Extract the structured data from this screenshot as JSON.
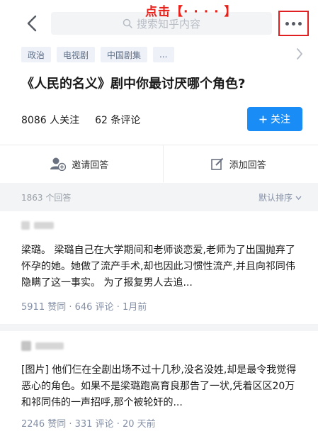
{
  "header": {
    "search_placeholder": "搜索知乎内容",
    "annotation": "点击【· · · · 】"
  },
  "topics": [
    "政治",
    "电视剧",
    "中国剧集",
    "..."
  ],
  "question": {
    "title": "《人民的名义》剧中你最讨厌哪个角色?",
    "followers": "8086 人关注",
    "comments": "62 条评论",
    "follow_label": "关注"
  },
  "actions": {
    "invite": "邀请回答",
    "add": "添加回答"
  },
  "answers_header": {
    "count": "1863 个回答",
    "sort": "默认排序"
  },
  "answers": [
    {
      "text": "梁璐。 梁璐自己在大学期间和老师谈恋爱,老师为了出国抛弃了怀孕的她。她做了流产手术,却也因此习惯性流产,并且向祁同伟隐瞒了这一事实。 为了报复男人去追...",
      "meta": "5911 赞同 · 646 评论 · 1月前"
    },
    {
      "text": "[图片] 他们仨在全剧出场不过十几秒,没名没姓,却是最令我觉得恶心的角色。如果不是梁璐跑高育良那告了一状,凭着区区20万和祁同伟的一声招呼,那个被轮奸的...",
      "meta": "2246 赞同 · 331 评论 · 20 天前"
    }
  ],
  "colors": {
    "accent": "#1a8cf5",
    "annotation_red": "#e8211a",
    "topic_bg": "#eef2f8",
    "topic_text": "#5f6f87",
    "meta_text": "#8590a6",
    "section_bg": "#f3f4f6"
  },
  "icons": [
    "back-chevron",
    "search",
    "more-dots",
    "chevron-right",
    "plus",
    "invite-user",
    "edit",
    "chevron-down"
  ]
}
